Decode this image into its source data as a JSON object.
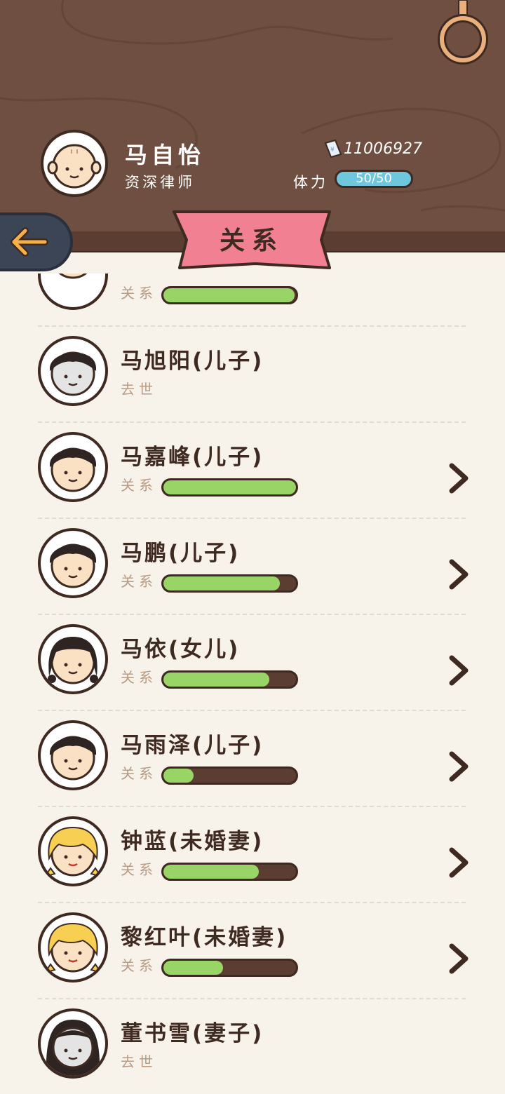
{
  "header": {
    "player_name": "马自怡",
    "player_title": "资深律师",
    "money": "11006927",
    "stamina_label": "体力",
    "stamina_value": "50/50"
  },
  "banner": {
    "title": "关系"
  },
  "relations": [
    {
      "name": "",
      "sub": "关系",
      "progress": 0.99,
      "status": "alive",
      "avatar": "partial"
    },
    {
      "name": "马旭阳(儿子)",
      "sub": "去世",
      "status": "deceased",
      "avatar": "boy-gray"
    },
    {
      "name": "马嘉峰(儿子)",
      "sub": "关系",
      "progress": 1.0,
      "status": "alive",
      "avatar": "boy"
    },
    {
      "name": "马鹏(儿子)",
      "sub": "关系",
      "progress": 0.88,
      "status": "alive",
      "avatar": "boy"
    },
    {
      "name": "马依(女儿)",
      "sub": "关系",
      "progress": 0.8,
      "status": "alive",
      "avatar": "girl"
    },
    {
      "name": "马雨泽(儿子)",
      "sub": "关系",
      "progress": 0.23,
      "status": "alive",
      "avatar": "boy"
    },
    {
      "name": "钟蓝(未婚妻)",
      "sub": "关系",
      "progress": 0.72,
      "status": "alive",
      "avatar": "blonde"
    },
    {
      "name": "黎红叶(未婚妻)",
      "sub": "关系",
      "progress": 0.45,
      "status": "alive",
      "avatar": "blonde"
    },
    {
      "name": "董书雪(妻子)",
      "sub": "去世",
      "status": "deceased",
      "avatar": "woman-gray"
    }
  ],
  "colors": {
    "header_bg": "#6f4f41",
    "list_bg": "#f8f3ea",
    "progress_fill": "#98d566",
    "progress_track": "#5b3d31",
    "banner": "#f28093",
    "stamina_pill": "#6fc7de"
  }
}
